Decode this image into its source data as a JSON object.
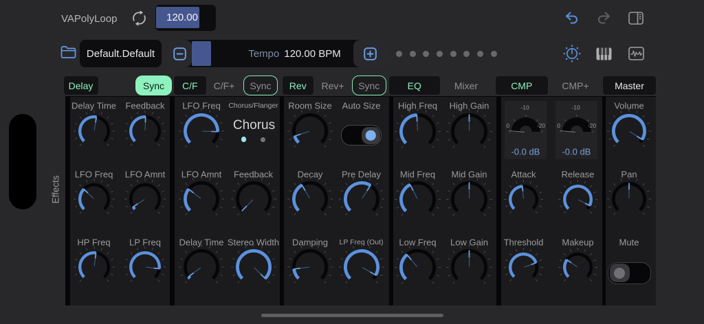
{
  "header": {
    "app_name": "VAPolyLoop",
    "tempo_field_value": "120.00",
    "icons": [
      "loop-icon",
      "undo-icon",
      "redo-icon",
      "sidebar-right-icon"
    ]
  },
  "transport": {
    "preset_name": "Default.Default",
    "decrement_label": "minus",
    "increment_label": "plus",
    "tempo_label": "Tempo",
    "tempo_value": "120.00 BPM",
    "page_dot_count": 8,
    "icons": [
      "folder-icon",
      "dial-icon",
      "piano-icon",
      "waveform-icon"
    ]
  },
  "tabs": [
    {
      "label": "Delay",
      "variant": "box"
    },
    {
      "label": "Sync",
      "variant": "filled"
    },
    {
      "label": "C/F",
      "variant": "box"
    },
    {
      "label": "C/F+",
      "variant": "plain"
    },
    {
      "label": "Sync",
      "variant": "outline"
    },
    {
      "label": "Rev",
      "variant": "box"
    },
    {
      "label": "Rev+",
      "variant": "plain"
    },
    {
      "label": "Sync",
      "variant": "outline"
    },
    {
      "label": "EQ",
      "variant": "box"
    },
    {
      "label": "Mixer",
      "variant": "plain"
    },
    {
      "label": "CMP",
      "variant": "box"
    },
    {
      "label": "CMP+",
      "variant": "plain"
    },
    {
      "label": "Master",
      "variant": "box-white"
    }
  ],
  "effects_rail_label": "Effects",
  "colors": {
    "accent_blue": "#5c91dd",
    "icon_blue": "#649bea",
    "selection_indigo": "#46578f",
    "mint_green": "#8df2be",
    "meter_text_blue": "#76a0d8",
    "chorus_dot_cyan": "#9ce9f2"
  },
  "panels": [
    {
      "id": "delay",
      "rows": [
        [
          {
            "type": "knob",
            "label": "Delay Time",
            "angle": 9
          },
          {
            "type": "knob",
            "label": "Feedback",
            "angle": 2
          }
        ],
        [
          {
            "type": "knob",
            "label": "LFO Freq",
            "angle": -46
          },
          {
            "type": "knob",
            "label": "LFO Amnt",
            "angle": -123
          }
        ],
        [
          {
            "type": "knob",
            "label": "HP Freq",
            "angle": 7
          },
          {
            "type": "knob",
            "label": "LP Freq",
            "angle": 97
          }
        ]
      ]
    },
    {
      "id": "chorus-flanger",
      "rows": [
        [
          {
            "type": "knob",
            "label": "LFO Freq",
            "angle": 92
          },
          {
            "type": "selector",
            "label": "Chorus/Flanger",
            "value": "Chorus",
            "dots": 2,
            "active_dot": 0
          }
        ],
        [
          {
            "type": "knob",
            "label": "LFO Amnt",
            "angle": -52
          },
          {
            "type": "knob",
            "label": "Feedback",
            "angle": -135
          }
        ],
        [
          {
            "type": "knob",
            "label": "Delay Time",
            "angle": -127
          },
          {
            "type": "knob",
            "label": "Stereo Width",
            "angle": 135
          }
        ]
      ]
    },
    {
      "id": "reverb",
      "rows": [
        [
          {
            "type": "knob",
            "label": "Room Size",
            "angle": -108
          },
          {
            "type": "toggle",
            "label": "Auto Size",
            "state": "on"
          }
        ],
        [
          {
            "type": "knob",
            "label": "Decay",
            "angle": -30
          },
          {
            "type": "knob",
            "label": "Pre Delay",
            "angle": 33
          }
        ],
        [
          {
            "type": "knob",
            "label": "Damping",
            "angle": -97
          },
          {
            "type": "knob",
            "label": "LP Freq (Out)",
            "angle": 120,
            "small_label": true
          }
        ]
      ]
    },
    {
      "id": "eq",
      "rows": [
        [
          {
            "type": "knob",
            "label": "High Freq",
            "angle": -3
          },
          {
            "type": "knob",
            "label": "High Gain",
            "angle": 0,
            "arc": "none"
          }
        ],
        [
          {
            "type": "knob",
            "label": "Mid Freq",
            "angle": -27
          },
          {
            "type": "knob",
            "label": "Mid Gain",
            "angle": 0,
            "arc": "none"
          }
        ],
        [
          {
            "type": "knob",
            "label": "Low Freq",
            "angle": -40
          },
          {
            "type": "knob",
            "label": "Low Gain",
            "angle": 0,
            "arc": "none"
          }
        ]
      ]
    },
    {
      "id": "compressor",
      "rows": [
        [
          {
            "type": "meter",
            "scale": [
              "0",
              "-10",
              "-20"
            ],
            "value_label": "-0.0 dB"
          },
          {
            "type": "meter",
            "scale": [
              "0",
              "-10",
              "-20"
            ],
            "value_label": "-0.0 dB"
          }
        ],
        [
          {
            "type": "knob",
            "label": "Attack",
            "angle": -5
          },
          {
            "type": "knob",
            "label": "Release",
            "angle": 118
          }
        ],
        [
          {
            "type": "knob",
            "label": "Threshold",
            "angle": 70
          },
          {
            "type": "knob",
            "label": "Makeup",
            "angle": -55
          }
        ]
      ]
    },
    {
      "id": "master",
      "rows": [
        [
          {
            "type": "knob",
            "label": "Volume",
            "angle": 123
          }
        ],
        [
          {
            "type": "knob",
            "label": "Pan",
            "angle": 0,
            "arc": "none"
          }
        ],
        [
          {
            "type": "toggle",
            "label": "Mute",
            "state": "off"
          }
        ]
      ]
    }
  ]
}
